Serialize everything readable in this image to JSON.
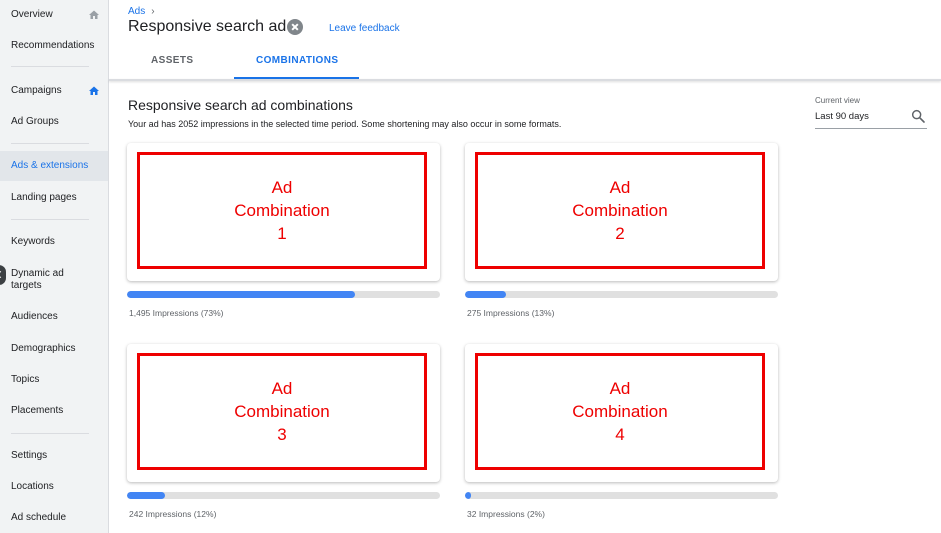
{
  "sidebar": {
    "items": [
      {
        "label": "Overview"
      },
      {
        "label": "Recommendations"
      },
      {
        "label": "Campaigns"
      },
      {
        "label": "Ad Groups"
      },
      {
        "label": "Ads & extensions"
      },
      {
        "label": "Landing pages"
      },
      {
        "label": "Keywords"
      },
      {
        "label": "Dynamic ad targets"
      },
      {
        "label": "Audiences"
      },
      {
        "label": "Demographics"
      },
      {
        "label": "Topics"
      },
      {
        "label": "Placements"
      },
      {
        "label": "Settings"
      },
      {
        "label": "Locations"
      },
      {
        "label": "Ad schedule"
      }
    ],
    "active_item": "Ads & extensions",
    "icons": {
      "overview": "home-icon",
      "campaigns": "home-icon"
    }
  },
  "header": {
    "breadcrumb": "Ads",
    "breadcrumb_separator": "›",
    "title": "Responsive search ad",
    "feedback": "Leave feedback",
    "tabs": [
      {
        "label": "ASSETS"
      },
      {
        "label": "COMBINATIONS"
      }
    ],
    "active_tab": "COMBINATIONS"
  },
  "main": {
    "section_title": "Responsive search ad combinations",
    "section_subtitle": "Your ad has 2052 impressions in the selected time period. Some shortening may also occur in some formats.",
    "current_view_label": "Current view",
    "current_view_value": "Last 90 days",
    "combinations": [
      {
        "line1": "Ad",
        "line2": "Combination",
        "line3": "1",
        "impressions_label": "1,495 Impressions (73%)",
        "share": 0.73
      },
      {
        "line1": "Ad",
        "line2": "Combination",
        "line3": "2",
        "impressions_label": "275 Impressions (13%)",
        "share": 0.13
      },
      {
        "line1": "Ad",
        "line2": "Combination",
        "line3": "3",
        "impressions_label": "242 Impressions (12%)",
        "share": 0.12
      },
      {
        "line1": "Ad",
        "line2": "Combination",
        "line3": "4",
        "impressions_label": "32 Impressions (2%)",
        "share": 0.02
      }
    ]
  },
  "colors": {
    "accent": "#1a73e8",
    "bar_fill": "#4285f4",
    "bar_track": "#e0e0e0",
    "highlight_border": "#ee0000"
  }
}
